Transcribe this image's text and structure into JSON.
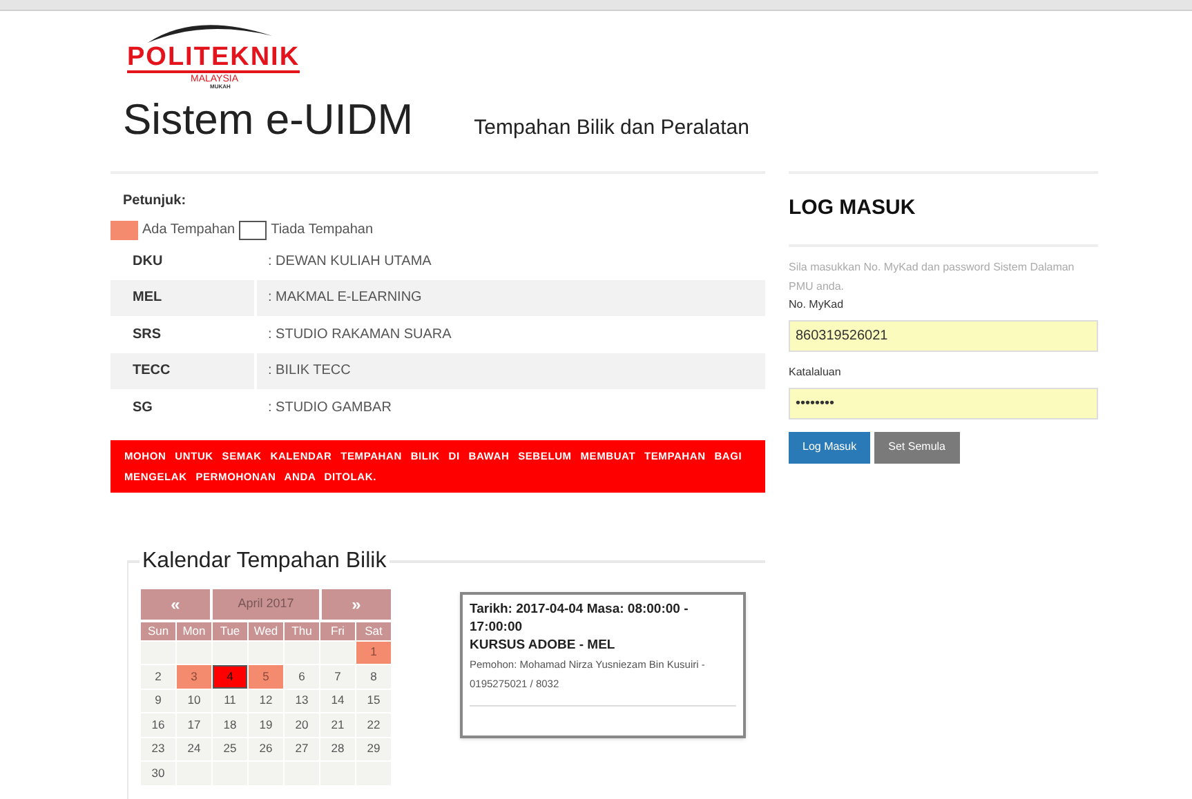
{
  "logo": {
    "name": "POLITEKNIK",
    "country": "MALAYSIA",
    "campus": "MUKAH"
  },
  "header": {
    "title": "Sistem e-UIDM",
    "subtitle": "Tempahan Bilik dan Peralatan"
  },
  "legend": {
    "title": "Petunjuk:",
    "items": [
      {
        "label": "Ada Tempahan",
        "booked": true
      },
      {
        "label": "Tiada Tempahan",
        "booked": false
      }
    ]
  },
  "rooms": [
    {
      "code": "DKU",
      "name": ": DEWAN KULIAH UTAMA"
    },
    {
      "code": "MEL",
      "name": ": MAKMAL E-LEARNING"
    },
    {
      "code": "SRS",
      "name": ": STUDIO RAKAMAN SUARA"
    },
    {
      "code": "TECC",
      "name": ": BILIK TECC"
    },
    {
      "code": "SG",
      "name": ": STUDIO GAMBAR"
    }
  ],
  "notice": "MOHON UNTUK SEMAK KALENDAR TEMPAHAN BILIK DI BAWAH SEBELUM MEMBUAT TEMPAHAN BAGI MENGELAK PERMOHONAN ANDA DITOLAK.",
  "calendar": {
    "legend": "Kalendar Tempahan Bilik",
    "prev": "«",
    "month": "April 2017",
    "next": "»",
    "weekdays": [
      "Sun",
      "Mon",
      "Tue",
      "Wed",
      "Thu",
      "Fri",
      "Sat"
    ],
    "weeks": [
      [
        {
          "day": "1",
          "booked": true,
          "selected": false
        }
      ],
      [
        {
          "day": "2",
          "booked": false,
          "selected": false
        },
        {
          "day": "3",
          "booked": true,
          "selected": false
        },
        {
          "day": "4",
          "booked": true,
          "selected": true
        },
        {
          "day": "5",
          "booked": true,
          "selected": false
        },
        {
          "day": "6",
          "booked": false,
          "selected": false
        },
        {
          "day": "7",
          "booked": false,
          "selected": false
        },
        {
          "day": "8",
          "booked": false,
          "selected": false
        }
      ],
      [
        {
          "day": "9",
          "booked": false,
          "selected": false
        },
        {
          "day": "10",
          "booked": false,
          "selected": false
        },
        {
          "day": "11",
          "booked": false,
          "selected": false
        },
        {
          "day": "12",
          "booked": false,
          "selected": false
        },
        {
          "day": "13",
          "booked": false,
          "selected": false
        },
        {
          "day": "14",
          "booked": false,
          "selected": false
        },
        {
          "day": "15",
          "booked": false,
          "selected": false
        }
      ],
      [
        {
          "day": "16",
          "booked": false,
          "selected": false
        },
        {
          "day": "17",
          "booked": false,
          "selected": false
        },
        {
          "day": "18",
          "booked": false,
          "selected": false
        },
        {
          "day": "19",
          "booked": false,
          "selected": false
        },
        {
          "day": "20",
          "booked": false,
          "selected": false
        },
        {
          "day": "21",
          "booked": false,
          "selected": false
        },
        {
          "day": "22",
          "booked": false,
          "selected": false
        }
      ],
      [
        {
          "day": "23",
          "booked": false,
          "selected": false
        },
        {
          "day": "24",
          "booked": false,
          "selected": false
        },
        {
          "day": "25",
          "booked": false,
          "selected": false
        },
        {
          "day": "26",
          "booked": false,
          "selected": false
        },
        {
          "day": "27",
          "booked": false,
          "selected": false
        },
        {
          "day": "28",
          "booked": false,
          "selected": false
        },
        {
          "day": "29",
          "booked": false,
          "selected": false
        }
      ],
      [
        {
          "day": "30",
          "booked": false,
          "selected": false
        }
      ]
    ]
  },
  "booking": {
    "heading": "Tarikh: 2017-04-04 Masa: 08:00:00 - 17:00:00",
    "event": "KURSUS ADOBE - MEL",
    "applicant": "Pemohon: Mohamad Nirza Yusniezam Bin Kusuiri - 0195275021 / 8032"
  },
  "login": {
    "title": "LOG MASUK",
    "hint": "Sila masukkan No. MyKad dan password Sistem Dalaman PMU anda.",
    "fields": [
      {
        "label": "No. MyKad",
        "value": "860319526021"
      },
      {
        "label": "Katalaluan",
        "value": "••••••••"
      }
    ],
    "buttons": [
      {
        "label": "Log Masuk",
        "kind": "primary"
      },
      {
        "label": "Set Semula",
        "kind": "secondary"
      }
    ]
  }
}
